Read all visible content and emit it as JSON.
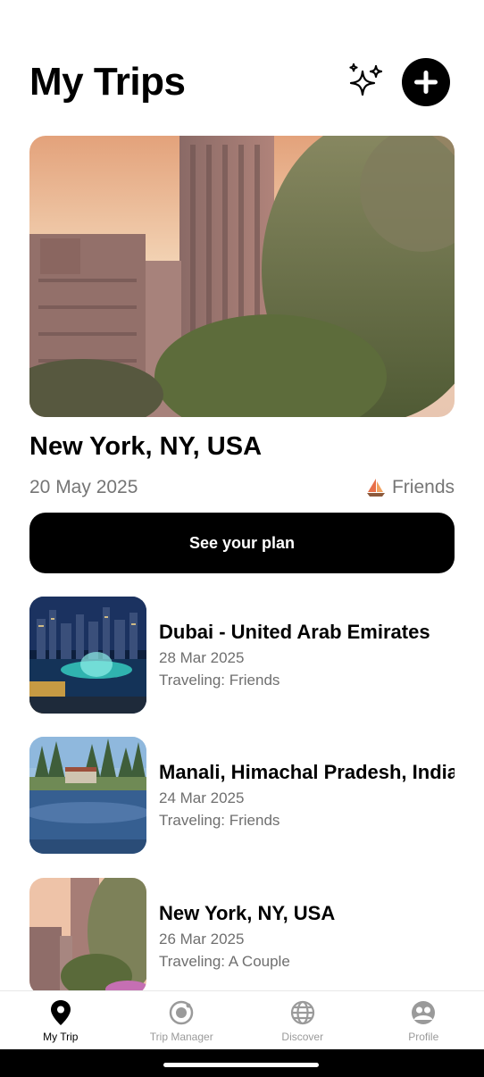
{
  "header": {
    "title": "My Trips"
  },
  "hero": {
    "title": "New York, NY, USA",
    "date": "20 May 2025",
    "company": "Friends",
    "cta": "See your plan"
  },
  "trips": [
    {
      "name": "Dubai - United Arab Emirates",
      "date": "28 Mar 2025",
      "traveling": "Traveling: Friends"
    },
    {
      "name": "Manali, Himachal Pradesh, India",
      "date": "24 Mar 2025",
      "traveling": "Traveling: Friends"
    },
    {
      "name": "New York, NY, USA",
      "date": "26 Mar 2025",
      "traveling": "Traveling: A Couple"
    }
  ],
  "nav": {
    "items": [
      {
        "label": "My Trip",
        "icon": "map-pin-icon",
        "active": true
      },
      {
        "label": "Trip Manager",
        "icon": "target-icon",
        "active": false
      },
      {
        "label": "Discover",
        "icon": "globe-icon",
        "active": false
      },
      {
        "label": "Profile",
        "icon": "profile-icon",
        "active": false
      }
    ]
  },
  "colors": {
    "primary": "#000000",
    "muted": "#757575",
    "inactive_nav": "#9a9a9a"
  }
}
